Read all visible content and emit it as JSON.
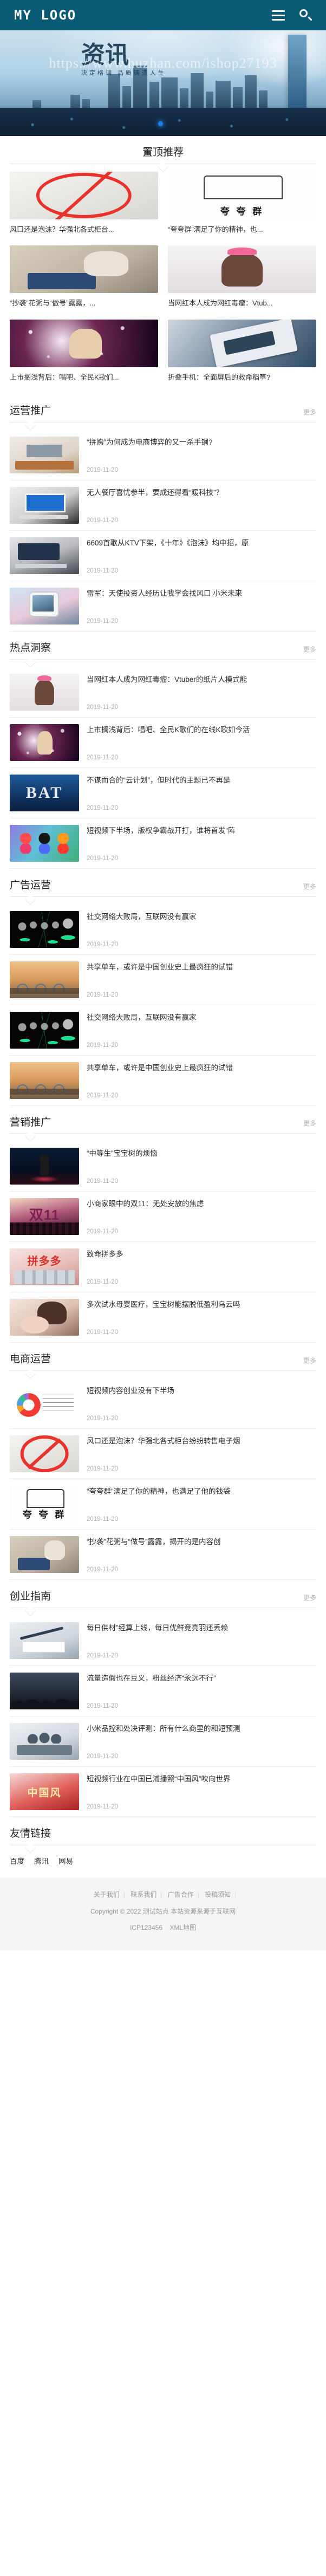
{
  "header": {
    "logo": "MY LOGO",
    "menu_icon": "hamburger-menu-icon",
    "search_icon": "search-icon"
  },
  "banner": {
    "watermark_url": "https://www.huzhan.com/ishop27193",
    "title_cn": "资讯",
    "subtitle_cn": "决定格调 品质铸造人生"
  },
  "featured": {
    "title": "置顶推荐",
    "cards": [
      {
        "title": "风口还是泡沫？华强北各式柜台...",
        "art": "art-nosmoke"
      },
      {
        "title": "“夸夸群”满足了你的精神，也...",
        "art": "art-kuakua"
      },
      {
        "title": "“抄袭”花粥与“做号”露露，...",
        "art": "art-typewriter"
      },
      {
        "title": "当网红本人成为网红毒瘤：Vtub...",
        "art": "art-anime"
      },
      {
        "title": "上市搁浅背后：唱吧、全民K歌们...",
        "art": "art-ktv"
      },
      {
        "title": "折叠手机：全面屏后的救命稻草?",
        "art": "art-foldphone"
      }
    ]
  },
  "sections": [
    {
      "title": "运营推广",
      "more": "更多",
      "items": [
        {
          "title": "“拼购”为何成为电商博弈的又一杀手锏?",
          "date": "2019-11-20",
          "art": "art-office"
        },
        {
          "title": "无人餐厅喜忧参半，要成还得看“暖科技”？",
          "date": "2019-11-20",
          "art": "art-laptop"
        },
        {
          "title": "6609首歌从KTV下架，《十年》《泡沫》均中招，原",
          "date": "2019-11-20",
          "art": "art-macbook"
        },
        {
          "title": "雷军：天使投资人经历让我学会找风口 小米未来",
          "date": "2019-11-20",
          "art": "art-phonecam"
        }
      ]
    },
    {
      "title": "热点洞察",
      "more": "更多",
      "items": [
        {
          "title": "当网红本人成为网红毒瘤：Vtuber的纸片人模式能",
          "date": "2019-11-20",
          "art": "art-anime"
        },
        {
          "title": "上市搁浅背后：唱吧、全民K歌们的在线K歌如今活",
          "date": "2019-11-20",
          "art": "art-ktv"
        },
        {
          "title": "不谋而合的“云计划”，但时代的主题已不再是",
          "date": "2019-11-20",
          "art": "art-bat"
        },
        {
          "title": "短视频下半场，版权争霸战开打，谁将首发“阵",
          "date": "2019-11-20",
          "art": "art-apps"
        }
      ]
    },
    {
      "title": "广告运营",
      "more": "更多",
      "items": [
        {
          "title": "社交网络大败局，互联网没有赢家",
          "date": "2019-11-20",
          "art": "art-network"
        },
        {
          "title": "共享单车，或许是中国创业史上最疯狂的试错",
          "date": "2019-11-20",
          "art": "art-bikes"
        },
        {
          "title": "社交网络大败局，互联网没有赢家",
          "date": "2019-11-20",
          "art": "art-network"
        },
        {
          "title": "共享单车，或许是中国创业史上最疯狂的试错",
          "date": "2019-11-20",
          "art": "art-bikes"
        }
      ]
    },
    {
      "title": "营销推广",
      "more": "更多",
      "items": [
        {
          "title": "“中等生”宝宝树的烦恼",
          "date": "2019-11-20",
          "art": "art-stage"
        },
        {
          "title": "小商家眼中的双11：无处安放的焦虑",
          "date": "2019-11-20",
          "art": "art-shuang11"
        },
        {
          "title": "致命拼多多",
          "date": "2019-11-20",
          "art": "art-pdd"
        },
        {
          "title": "多次试水母婴医疗，宝宝树能摆脱低盈利乌云吗",
          "date": "2019-11-20",
          "art": "art-mother"
        }
      ]
    },
    {
      "title": "电商运营",
      "more": "更多",
      "items": [
        {
          "title": "短视频内容创业没有下半场",
          "date": "2019-11-20",
          "art": "art-piechart"
        },
        {
          "title": "风口还是泡沫？华强北各式柜台纷纷转售电子烟",
          "date": "2019-11-20",
          "art": "art-nosmoke"
        },
        {
          "title": "“夸夸群”满足了你的精神，也满足了他的钱袋",
          "date": "2019-11-20",
          "art": "art-kuakua"
        },
        {
          "title": "“抄袭”花粥与“做号”露露，揭开的是内容创",
          "date": "2019-11-20",
          "art": "art-typewriter"
        }
      ]
    },
    {
      "title": "创业指南",
      "more": "更多",
      "items": [
        {
          "title": "每日供材”经算上线，每日优鲜竟亮羽还丢赖",
          "date": "2019-11-20",
          "art": "art-pen"
        },
        {
          "title": "流量造假也在豆义，粉丝经济“永远不行”",
          "date": "2019-11-20",
          "art": "art-crowd"
        },
        {
          "title": "小米品控和处决评测：所有什么商里的和短预测",
          "date": "2019-11-20",
          "art": "art-teamwork"
        },
        {
          "title": "短视频行业在中国已浦播照“中国风”吹向世界",
          "date": "2019-11-20",
          "art": "art-china"
        }
      ]
    }
  ],
  "friend_links": {
    "title": "友情链接",
    "links": [
      "百度",
      "腾讯",
      "网易"
    ]
  },
  "footer": {
    "nav": [
      "关于我们",
      "联系我们",
      "广告合作",
      "投稿须知"
    ],
    "separator": "|",
    "copyright": "Copyright © 2022 测试站点 本站资源来源于互联网",
    "icp": "ICP123456",
    "sitemap": "XML地图"
  }
}
